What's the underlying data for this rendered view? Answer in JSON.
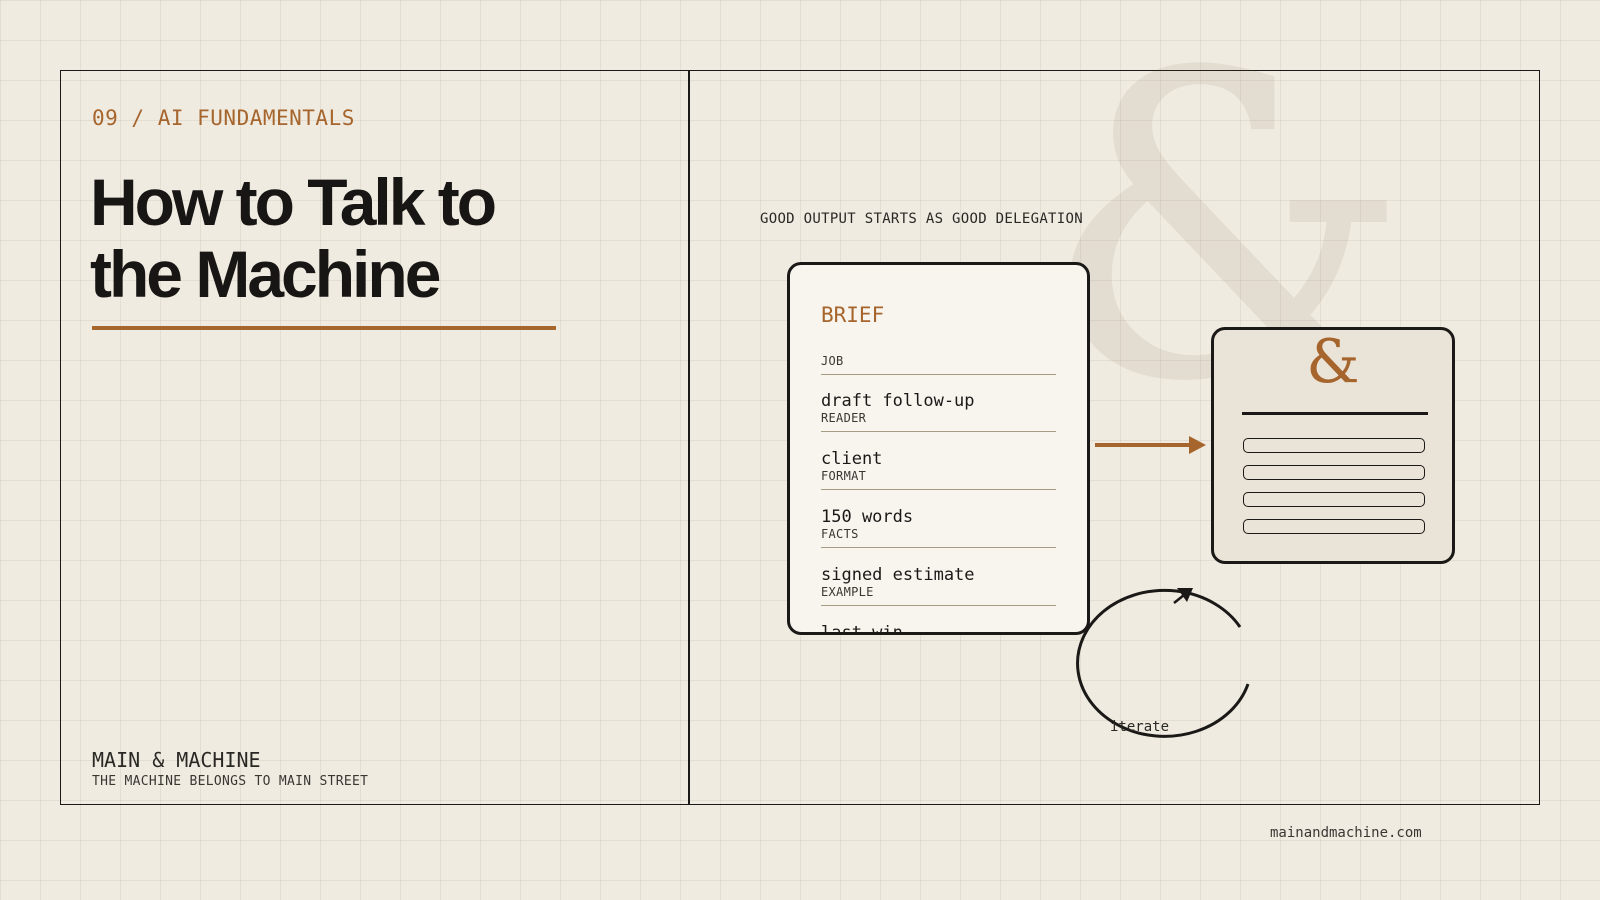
{
  "kicker": "09 / AI FUNDAMENTALS",
  "title_line1": "How to Talk to",
  "title_line2": "the Machine",
  "brand": "MAIN & MACHINE",
  "tagline": "THE MACHINE BELONGS TO MAIN STREET",
  "url": "mainandmachine.com",
  "diagram": {
    "caption": "GOOD OUTPUT STARTS AS GOOD DELEGATION",
    "brief": {
      "title": "BRIEF",
      "fields": [
        {
          "label": "JOB",
          "value": "draft follow-up"
        },
        {
          "label": "READER",
          "value": "client"
        },
        {
          "label": "FORMAT",
          "value": "150 words"
        },
        {
          "label": "FACTS",
          "value": "signed estimate"
        },
        {
          "label": "EXAMPLE",
          "value": "last win"
        }
      ]
    },
    "output_card": {
      "symbol": "&",
      "line_count": 4
    },
    "loop_label": "iterate",
    "background_symbol": "&"
  },
  "colors": {
    "accent": "#a5652d",
    "ink": "#1a1917",
    "paper": "#f0ebe1",
    "card": "#f8f5ef",
    "output_card": "#eae3d7"
  }
}
